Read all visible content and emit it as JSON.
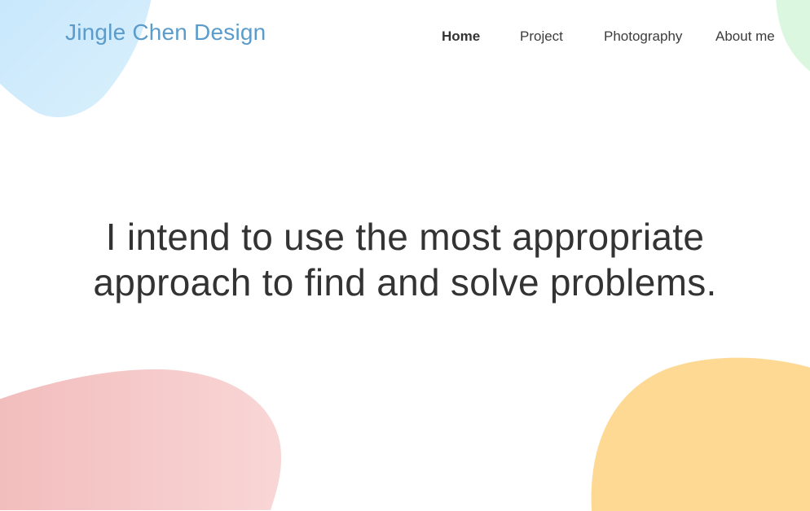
{
  "site": {
    "logo": "Jingle Chen Design"
  },
  "nav": {
    "items": [
      {
        "label": "Home"
      },
      {
        "label": "Project"
      },
      {
        "label": "Photography"
      },
      {
        "label": "About me"
      }
    ],
    "active": "Home"
  },
  "hero": {
    "line1": "I intend to use the most appropriate",
    "line2": "approach to find and solve problems."
  },
  "theme": {
    "logo_color": "#5b9ccb",
    "text_color": "#333333",
    "blob_blue": "#cfeafc",
    "blob_green": "#dcf7e0",
    "blob_pink": "#f4c3c3",
    "blob_yellow": "#fdd994"
  }
}
